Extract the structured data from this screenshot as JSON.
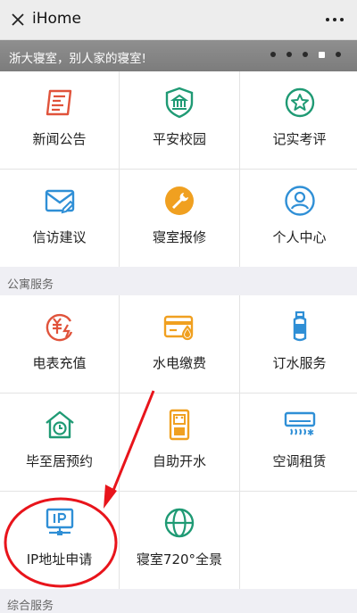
{
  "topbar": {
    "title": "iHome"
  },
  "banner": {
    "text": "浙大寝室，别人家的寝室!",
    "dot_count": 5,
    "active_dot": 4
  },
  "sections": {
    "apartment": "公寓服务",
    "general": "综合服务"
  },
  "grid1": [
    {
      "label": "新闻公告",
      "icon": "news-icon",
      "color": "#e0533b"
    },
    {
      "label": "平安校园",
      "icon": "shield-icon",
      "color": "#1f9a74"
    },
    {
      "label": "记实考评",
      "icon": "star-badge-icon",
      "color": "#1f9a74"
    },
    {
      "label": "信访建议",
      "icon": "mail-icon",
      "color": "#2f8fd6"
    },
    {
      "label": "寝室报修",
      "icon": "wrench-icon",
      "color": "#f0a020"
    },
    {
      "label": "个人中心",
      "icon": "user-icon",
      "color": "#2f8fd6"
    }
  ],
  "grid2": [
    {
      "label": "电表充值",
      "icon": "electric-meter-icon",
      "color": "#e0533b"
    },
    {
      "label": "水电缴费",
      "icon": "card-water-icon",
      "color": "#f0a020"
    },
    {
      "label": "订水服务",
      "icon": "water-bottle-icon",
      "color": "#2f8fd6"
    },
    {
      "label": "毕至居预约",
      "icon": "house-clock-icon",
      "color": "#1f9a74"
    },
    {
      "label": "自助开水",
      "icon": "water-dispenser-icon",
      "color": "#f0a020"
    },
    {
      "label": "空调租赁",
      "icon": "air-conditioner-icon",
      "color": "#2f8fd6"
    },
    {
      "label": "IP地址申请",
      "icon": "ip-icon",
      "color": "#2f8fd6"
    },
    {
      "label": "寝室720°全景",
      "icon": "globe-icon",
      "color": "#1f9a74"
    },
    {
      "label": "",
      "icon": "",
      "color": ""
    }
  ],
  "annotation": {
    "color": "#e8141b"
  }
}
